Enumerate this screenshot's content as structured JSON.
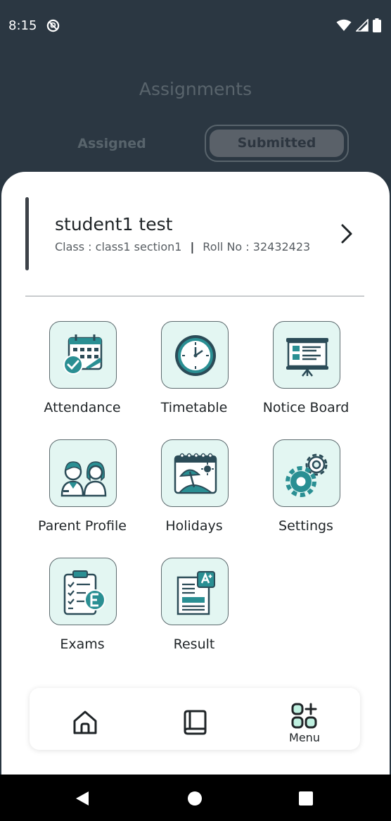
{
  "status_bar": {
    "time": "8:15"
  },
  "header": {
    "title": "Assignments",
    "tabs": [
      {
        "label": "Assigned",
        "selected": false
      },
      {
        "label": "Submitted",
        "selected": true
      }
    ]
  },
  "profile": {
    "name": "student1 test",
    "class_text": "Class : class1 section1",
    "separator": "|",
    "roll_text": "Roll No : 32432423"
  },
  "menu": {
    "items": [
      {
        "label": "Attendance",
        "icon": "attendance-calendar-icon"
      },
      {
        "label": "Timetable",
        "icon": "clock-icon"
      },
      {
        "label": "Notice Board",
        "icon": "notice-board-icon"
      },
      {
        "label": "Parent Profile",
        "icon": "parents-icon"
      },
      {
        "label": "Holidays",
        "icon": "beach-calendar-icon"
      },
      {
        "label": "Settings",
        "icon": "gears-icon"
      },
      {
        "label": "Exams",
        "icon": "exam-clipboard-icon"
      },
      {
        "label": "Result",
        "icon": "result-report-icon"
      }
    ]
  },
  "bottom_nav": {
    "items": [
      {
        "name": "home",
        "icon": "home-icon",
        "label": ""
      },
      {
        "name": "book",
        "icon": "book-icon",
        "label": ""
      },
      {
        "name": "menu",
        "icon": "grid-plus-icon",
        "label": "Menu",
        "active": true
      }
    ]
  },
  "colors": {
    "tile_background": "#e3f6f2",
    "icon_teal": "#2a8f93",
    "icon_dark": "#2b4b57",
    "header_background": "#2b3742"
  }
}
